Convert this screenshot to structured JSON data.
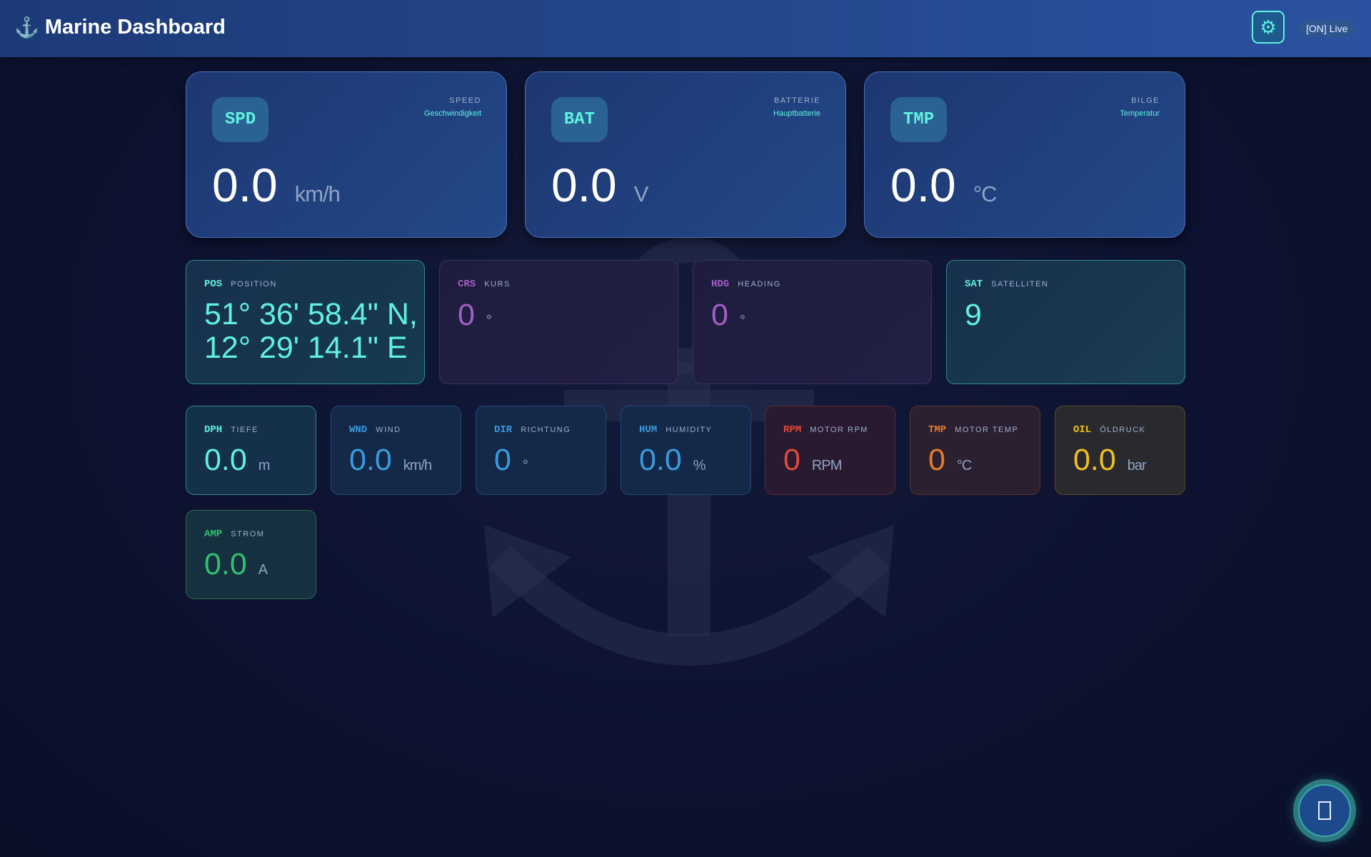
{
  "header": {
    "brand_icon": "anchor-icon",
    "brand_glyph": "⚓",
    "title": "Marine Dashboard",
    "settings_icon": "gear-icon",
    "settings_glyph": "⚙",
    "live_label": "[ON] Live"
  },
  "big_cards": [
    {
      "code": "SPD",
      "label": "SPEED",
      "sublabel": "Geschwindigkeit",
      "value": "0.0",
      "unit": "km/h"
    },
    {
      "code": "BAT",
      "label": "BATTERIE",
      "sublabel": "Hauptbatterie",
      "value": "0.0",
      "unit": "V"
    },
    {
      "code": "TMP",
      "label": "BILGE",
      "sublabel": "Temperatur",
      "value": "0.0",
      "unit": "°C"
    }
  ],
  "mid_cards": [
    {
      "code": "POS",
      "label": "POSITION",
      "value_line1": "51° 36' 58.4\" N,",
      "value_line2": "12° 29' 14.1\" E",
      "color": "#5ff1e0"
    },
    {
      "code": "CRS",
      "label": "KURS",
      "value": "0",
      "unit": "°",
      "color": "#a35fc3"
    },
    {
      "code": "HDG",
      "label": "HEADING",
      "value": "0",
      "unit": "°",
      "color": "#a35fc3"
    },
    {
      "code": "SAT",
      "label": "SATELLITEN",
      "value": "9",
      "unit": "",
      "color": "#5ff1e0"
    }
  ],
  "small_cards": [
    {
      "code": "DPH",
      "label": "TIEFE",
      "value": "0.0",
      "unit": "m",
      "color": "#5ff1e0"
    },
    {
      "code": "WND",
      "label": "WIND",
      "value": "0.0",
      "unit": "km/h",
      "color": "#3a9ade"
    },
    {
      "code": "DIR",
      "label": "RICHTUNG",
      "value": "0",
      "unit": "°",
      "color": "#3a9ade"
    },
    {
      "code": "HUM",
      "label": "HUMIDITY",
      "value": "0.0",
      "unit": "%",
      "color": "#3a9ade"
    },
    {
      "code": "RPM",
      "label": "MOTOR RPM",
      "value": "0",
      "unit": "RPM",
      "color": "#e04a3c"
    },
    {
      "code": "TMP",
      "label": "MOTOR TEMP",
      "value": "0",
      "unit": "°C",
      "color": "#ea7a2a"
    },
    {
      "code": "OIL",
      "label": "ÖLDRUCK",
      "value": "0.0",
      "unit": "bar",
      "color": "#f0c020"
    },
    {
      "code": "AMP",
      "label": "STROM",
      "value": "0.0",
      "unit": "A",
      "color": "#30c070"
    }
  ],
  "fab": {
    "icon": "sidebar-toggle-icon"
  }
}
